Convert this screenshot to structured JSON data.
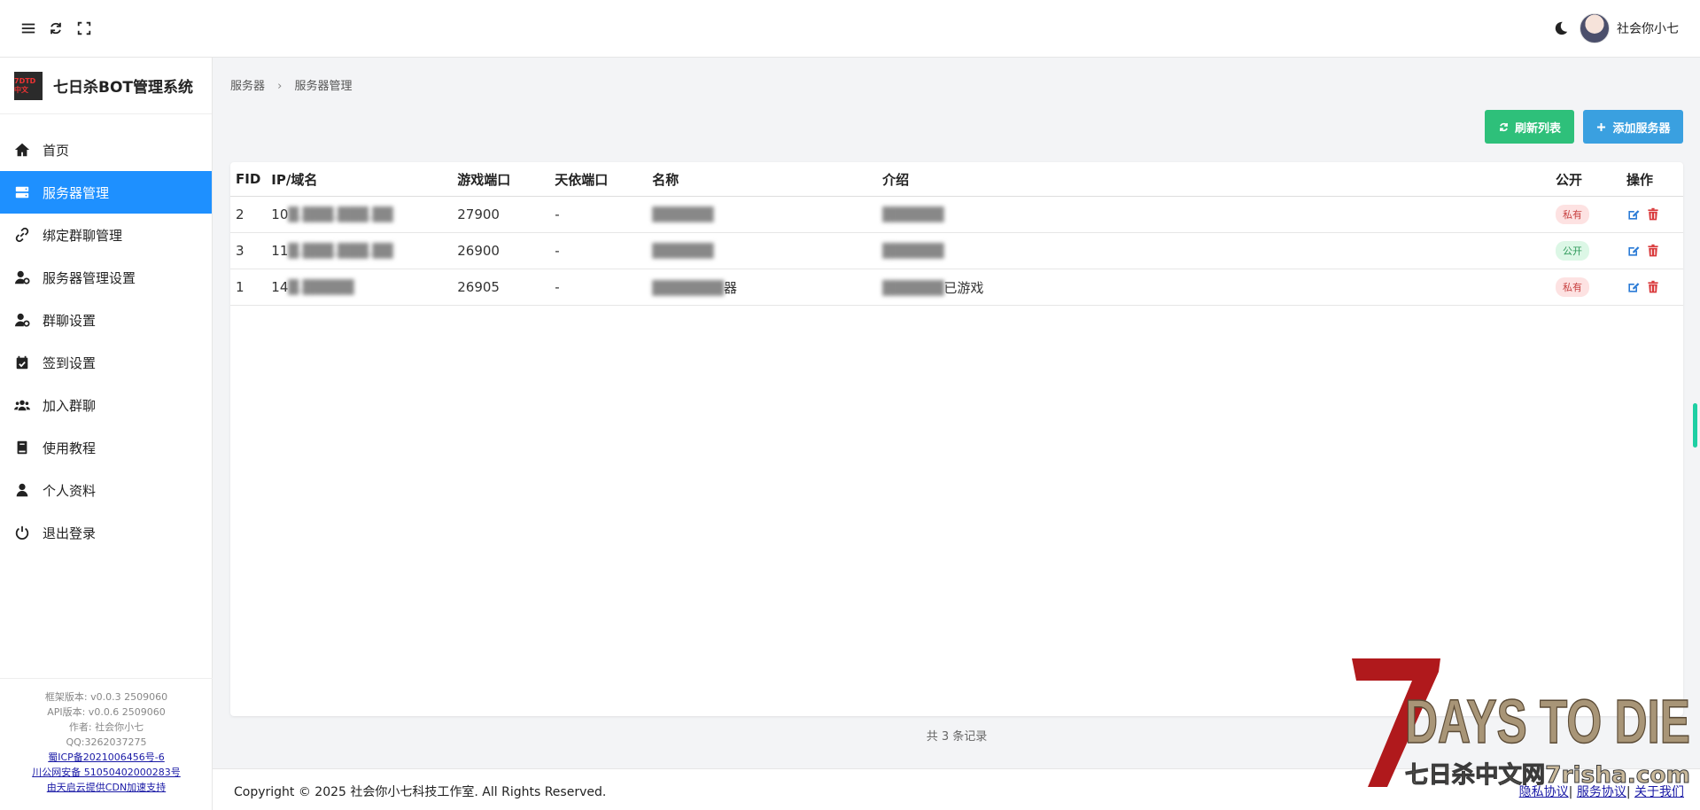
{
  "user": {
    "name": "社会你小七"
  },
  "brand": {
    "title": "七日杀BOT管理系统",
    "logo_text": "7DTD 中文"
  },
  "menu": [
    {
      "label": "首页",
      "icon": "home-icon"
    },
    {
      "label": "服务器管理",
      "icon": "server-icon",
      "active": true
    },
    {
      "label": "绑定群聊管理",
      "icon": "link-icon"
    },
    {
      "label": "服务器管理设置",
      "icon": "user-gear-icon"
    },
    {
      "label": "群聊设置",
      "icon": "user-gear-icon"
    },
    {
      "label": "签到设置",
      "icon": "calendar-check-icon"
    },
    {
      "label": "加入群聊",
      "icon": "users-icon"
    },
    {
      "label": "使用教程",
      "icon": "book-icon"
    },
    {
      "label": "个人资料",
      "icon": "user-icon"
    },
    {
      "label": "退出登录",
      "icon": "power-icon"
    }
  ],
  "side_footer": {
    "framework_version": "框架版本: v0.0.3 2509060",
    "api_version": "API版本: v0.0.6 2509060",
    "author": "作者: 社会你小七",
    "qq": "QQ:3262037275",
    "icp": "蜀ICP备2021006456号-6",
    "police": "川公网安备 51050402000283号",
    "cdn": "由天启云提供CDN加速支持"
  },
  "breadcrumb": {
    "parent": "服务器",
    "current": "服务器管理"
  },
  "actions": {
    "refresh": "刷新列表",
    "add": "添加服务器"
  },
  "table": {
    "headers": [
      "FID",
      "IP/域名",
      "游戏端口",
      "天依端口",
      "名称",
      "介绍",
      "公开",
      "操作"
    ],
    "rows": [
      {
        "fid": "2",
        "ip": "10",
        "ip_hidden": "█.███.███.██",
        "port": "27900",
        "tianyi": "-",
        "name_hidden": "██████",
        "name_tail": "",
        "intro_hidden": "██████",
        "intro_tail": "",
        "visibility": "私有",
        "visibility_type": "private"
      },
      {
        "fid": "3",
        "ip": "11",
        "ip_hidden": "█.███.███.██",
        "port": "26900",
        "tianyi": "-",
        "name_hidden": "██████",
        "name_tail": "",
        "intro_hidden": "██████",
        "intro_tail": "",
        "visibility": "公开",
        "visibility_type": "public"
      },
      {
        "fid": "1",
        "ip": "14",
        "ip_hidden": "█.█████",
        "port": "26905",
        "tianyi": "-",
        "name_hidden": "███████",
        "name_tail": "器",
        "intro_hidden": "██████",
        "intro_tail": "已游戏",
        "visibility": "私有",
        "visibility_type": "private"
      }
    ]
  },
  "total_text": "共 3 条记录",
  "footer": {
    "copyright": "Copyright © 2025 社会你小七科技工作室. All Rights Reserved.",
    "privacy": "隐私协议",
    "service": "服务协议",
    "about": "关于我们"
  },
  "watermark": {
    "main": "DAYS TO DIE",
    "sub": "七日杀中文网7risha.com"
  },
  "colors": {
    "accent": "#1e90ff",
    "refresh": "#2ec07a",
    "add": "#3aa0e0"
  }
}
